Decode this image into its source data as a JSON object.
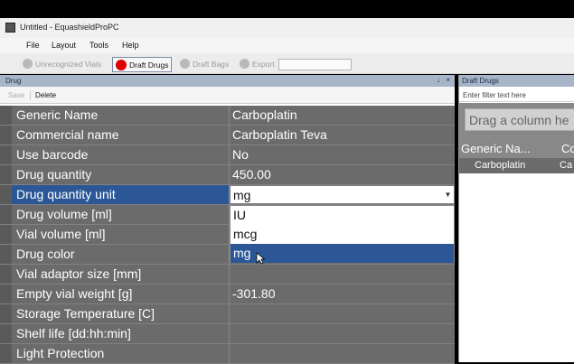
{
  "window": {
    "title": "Untitled - EquashieldProPC"
  },
  "menu": [
    "File",
    "Layout",
    "Tools",
    "Help"
  ],
  "toolbar": {
    "unrecognized_vials": "Unrecognized Vials",
    "draft_drugs": "Draft Drugs",
    "draft_bags": "Draft Bags",
    "export": "Export",
    "progress": 0
  },
  "drug_panel": {
    "title": "Drug",
    "pin": "↓",
    "close": "×",
    "save": "Save",
    "delete": "Delete",
    "rows": [
      {
        "label": "Generic Name",
        "value": "Carboplatin"
      },
      {
        "label": "Commercial name",
        "value": "Carboplatin Teva"
      },
      {
        "label": "Use barcode",
        "value": "No"
      },
      {
        "label": "Drug quantity",
        "value": "450.00"
      },
      {
        "label": "Drug quantity unit",
        "value": "mg"
      },
      {
        "label": "Drug volume [ml]",
        "value": ""
      },
      {
        "label": "Vial volume [ml]",
        "value": ""
      },
      {
        "label": "Drug color",
        "value": ""
      },
      {
        "label": "Vial adaptor size [mm]",
        "value": ""
      },
      {
        "label": "Empty vial weight [g]",
        "value": "-301.80"
      },
      {
        "label": "Storage Temperature [C]",
        "value": ""
      },
      {
        "label": "Shelf life [dd:hh:min]",
        "value": ""
      },
      {
        "label": "Light Protection",
        "value": ""
      }
    ],
    "dropdown_options": [
      "IU",
      "mcg",
      "mg"
    ],
    "dropdown_selected": "mg"
  },
  "draft_panel": {
    "title": "Draft Drugs",
    "filter_placeholder": "Enter filter text here",
    "group_hint": "Drag a column he",
    "columns": [
      "Generic Na...",
      "Co"
    ],
    "row": [
      "Carboplatin",
      "Ca"
    ]
  },
  "colors": {
    "selection": "#2b5797",
    "grid_bg": "#6b6b6b",
    "draft_active": "#e00000"
  }
}
